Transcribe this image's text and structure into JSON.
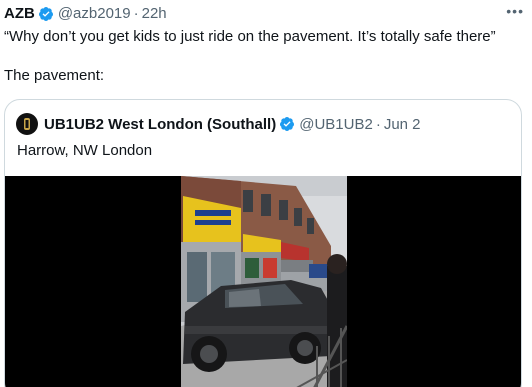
{
  "tweet": {
    "author_name": "AZB",
    "author_handle": "@azb2019",
    "separator": "·",
    "time": "22h",
    "more_icon": "more-horizontal-icon",
    "text_line1": "“Why don’t you get kids to just ride on the pavement. It’s totally safe there”",
    "text_line2": "The pavement:"
  },
  "quote": {
    "author_name": "UB1UB2 West London (Southall)",
    "author_handle": "@UB1UB2",
    "separator": "·",
    "date": "Jun 2",
    "text": "Harrow, NW London",
    "media": {
      "type": "video",
      "description_icon": "street-scene-video"
    }
  },
  "colors": {
    "verified": "#1d9bf0",
    "secondary_text": "#536471",
    "border": "#cfd9de",
    "media_bg": "#000000"
  }
}
